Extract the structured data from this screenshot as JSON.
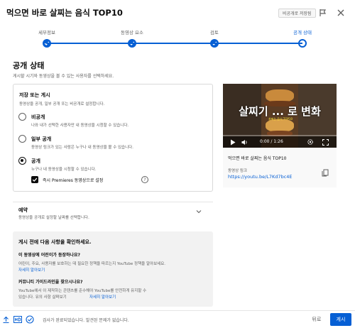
{
  "header": {
    "title": "먹으면 바로 살찌는 음식 TOP10",
    "save_badge": "비공개로 저장됨",
    "report_icon": "flag-icon",
    "close_icon": "close-icon"
  },
  "stepper": {
    "steps": [
      {
        "label": "세부정보",
        "state": "done"
      },
      {
        "label": "동영상 요소",
        "state": "done"
      },
      {
        "label": "검토",
        "state": "done"
      },
      {
        "label": "공개 상태",
        "state": "current"
      }
    ]
  },
  "visibility": {
    "title": "공개 상태",
    "subtitle": "게시할 시기와 동영상을 볼 수 있는 사용자를 선택하세요.",
    "card": {
      "title": "저장 또는 게시",
      "subtitle": "동영상을 공개, 일부 공개 또는 비공개로 설정합니다.",
      "options": [
        {
          "label": "비공개",
          "desc": "나와 내가 선택한 사용자만 내 동영상을 시청할 수 있습니다.",
          "selected": false
        },
        {
          "label": "일부 공개",
          "desc": "동영상 링크가 있는 사람은 누구나 내 동영상을 볼 수 있습니다.",
          "selected": false
        },
        {
          "label": "공개",
          "desc": "누구나 내 동영상을 시청할 수 있습니다.",
          "selected": true
        }
      ],
      "premiere_label": "즉시 Premieres 동영상으로 설정",
      "premiere_checked": true,
      "help_glyph": "?"
    },
    "schedule": {
      "title": "예약",
      "subtitle": "동영상을 공개로 설정할 날짜를 선택합니다."
    },
    "check": {
      "title": "게시 전에 다음 사항을 확인하세요.",
      "q1": "이 동영상에 어린이가 등장하나요?",
      "a1_line1": "어린이, 주요, 사용자를 보호하는 데 필요한 정책을 따르는지 YouTube 정책을 알아보세요.",
      "a1_link": "자세히 알아보기",
      "q2": "커뮤니티 가이드라인을 찾으시나요?",
      "a2_line1": "YouTube에서 이 제작하는 콘텐츠를 준수해야 YouTube를 안전하게 유지할 수",
      "a2_line2": "있습니다. 유의 사항 살펴보기",
      "a2_link": "자세히 알아보기"
    }
  },
  "video": {
    "overlay_text": "살찌기 ... 로 변화",
    "caption": "살찌는 음식 TOP10",
    "time": "0:00 / 1:26",
    "progress": 0,
    "title": "먹으면 바로 살찌는 음식 TOP10",
    "link_label": "동영상 링크",
    "link": "https://youtu.be/L7Kd7bc4E",
    "icons": {
      "play": "play-icon",
      "volume": "volume-icon",
      "settings": "gear-icon",
      "fullscreen": "fullscreen-icon",
      "copy": "copy-icon"
    }
  },
  "footer": {
    "status": "검사가 완료되었습니다. 발견된 문제가 없습니다.",
    "back_label": "뒤로",
    "publish_label": "게시",
    "icons": {
      "upload": "upload-icon",
      "hd": "hd-icon",
      "checks": "checks-icon"
    }
  },
  "colors": {
    "accent": "#065fd4",
    "text": "#0d0d0d",
    "muted": "#606060"
  }
}
